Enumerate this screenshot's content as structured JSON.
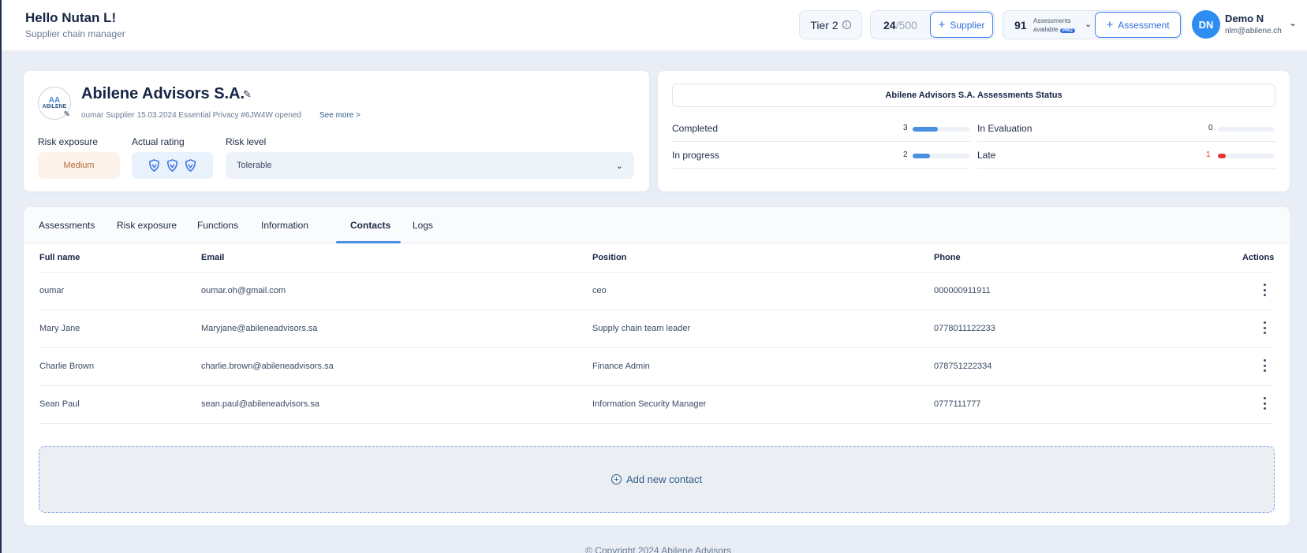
{
  "header": {
    "greeting": "Hello Nutan L!",
    "role": "Supplier chain manager",
    "tier_label": "Tier 2",
    "supplier_count": "24",
    "supplier_limit": "/500",
    "supplier_button": "Supplier",
    "assessments_count": "91",
    "assessments_label_1": "Assessments",
    "assessments_label_2": "available",
    "pro_badge": "PRO",
    "assessment_button": "Assessment",
    "avatar_initials": "DN",
    "user_name": "Demo N",
    "user_email": "nlm@abilene.ch"
  },
  "company": {
    "logo_text": "ABILENE",
    "logo_sub": "AA",
    "name": "Abilene Advisors S.A.",
    "meta": "oumar Supplier 15.03.2024 Essential Privacy #6JW4W opened",
    "see_more": "See more >",
    "risk_exposure_label": "Risk exposure",
    "risk_exposure_value": "Medium",
    "actual_rating_label": "Actual rating",
    "actual_rating_shields": 3,
    "risk_level_label": "Risk level",
    "risk_level_value": "Tolerable"
  },
  "status": {
    "title": "Abilene Advisors S.A. Assessments Status",
    "items": [
      {
        "label": "Completed",
        "value": "3",
        "fraction": 0.45,
        "color": "#4a90e2"
      },
      {
        "label": "In progress",
        "value": "2",
        "fraction": 0.3,
        "color": "#4a90e2"
      },
      {
        "label": "In Evaluation",
        "value": "0",
        "fraction": 0,
        "color": "#4a90e2"
      },
      {
        "label": "Late",
        "value": "1",
        "fraction": 0.14,
        "color": "#e53935"
      }
    ]
  },
  "tabs": [
    "Assessments",
    "Risk exposure",
    "Functions",
    "Information",
    "Contacts",
    "Logs"
  ],
  "active_tab": "Contacts",
  "table": {
    "columns": [
      "Full name",
      "Email",
      "Position",
      "Phone",
      "Actions"
    ],
    "rows": [
      {
        "name": "oumar",
        "email": "oumar.oh@gmail.com",
        "position": "ceo",
        "phone": "000000911911"
      },
      {
        "name": "Mary Jane",
        "email": "Maryjane@abileneadvisors.sa",
        "position": "Supply chain team leader",
        "phone": "0778011122233"
      },
      {
        "name": "Charlie Brown",
        "email": "charlie.brown@abileneadvisors.sa",
        "position": "Finance Admin",
        "phone": "078751222334"
      },
      {
        "name": "Sean Paul",
        "email": "sean.paul@abileneadvisors.sa",
        "position": "Information Security Manager",
        "phone": "0777111777"
      }
    ]
  },
  "add_contact_label": "Add new contact",
  "footer": "© Copyright 2024 Abilene Advisors"
}
